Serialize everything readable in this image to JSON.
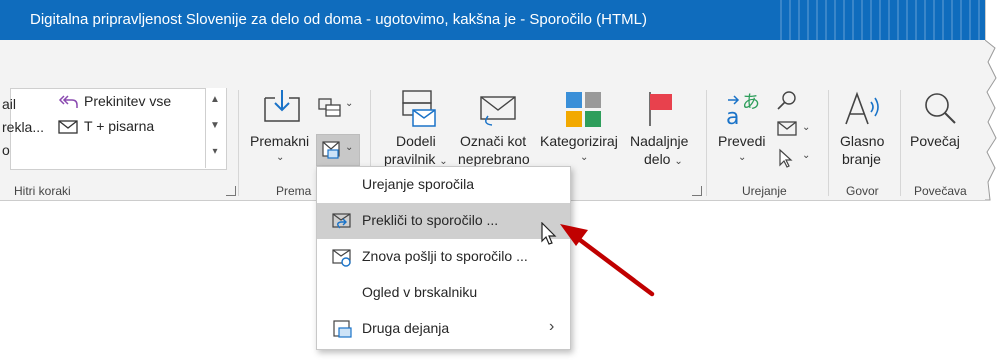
{
  "window": {
    "title": "Digitalna pripravljenost Slovenije za delo od doma - ugotovimo, kakšna je  -  Sporočilo (HTML)"
  },
  "quick_steps": {
    "left_fragments": [
      "ail",
      "rekla...",
      "o"
    ],
    "items": [
      {
        "label": "Prekinitev vse",
        "icon": "reply-all-icon"
      },
      {
        "label": "T + pisarna",
        "icon": "mail-icon"
      }
    ],
    "group_label": "Hitri koraki"
  },
  "move_group": {
    "move_label": "Premakni",
    "group_label": "Prema"
  },
  "tags_group": {
    "assign_label": [
      "Dodeli",
      "pravilnik"
    ],
    "mark_label": [
      "Označi kot",
      "neprebrano"
    ],
    "categorize_label": "Kategoriziraj",
    "followup_label": [
      "Nadaljnje",
      "delo"
    ]
  },
  "editing_group": {
    "translate_label": "Prevedi",
    "group_label": "Urejanje"
  },
  "speech_group": {
    "read_aloud_label": [
      "Glasno",
      "branje"
    ],
    "group_label": "Govor"
  },
  "zoom_group": {
    "zoom_label": "Povečaj",
    "group_label": "Povečava"
  },
  "dropdown": {
    "items": [
      {
        "label": "Urejanje sporočila",
        "icon": ""
      },
      {
        "label": "Prekliči to sporočilo ...",
        "icon": "recall-message-icon",
        "highlighted": true
      },
      {
        "label": "Znova pošlji to sporočilo ...",
        "icon": "resend-message-icon"
      },
      {
        "label": "Ogled v brskalniku",
        "icon": ""
      },
      {
        "label": "Druga dejanja",
        "icon": "other-actions-icon",
        "submenu": true
      }
    ]
  },
  "colors": {
    "titlebar": "#0f6cbd",
    "ribbon": "#f3f3f3",
    "arrow": "#c00000",
    "highlight": "#cfcfcf"
  }
}
